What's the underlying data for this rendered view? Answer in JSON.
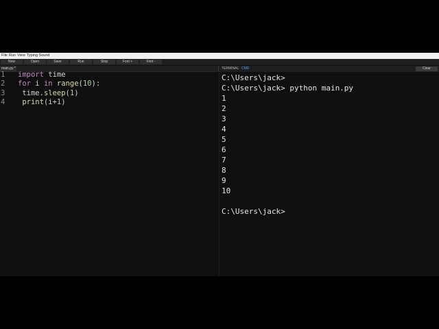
{
  "menubar": [
    "File",
    "Run",
    "View",
    "Typing Sound"
  ],
  "toolbar": {
    "new": "New",
    "open": "Open",
    "save": "Save",
    "run": "Run",
    "stop": "Stop",
    "font_plus": "Font +",
    "font_minus": "Font -"
  },
  "editor": {
    "tab_label": "main.py *",
    "lines": [
      {
        "num": "1",
        "tokens": [
          {
            "t": "import",
            "c": "kw"
          },
          {
            "t": " time",
            "c": ""
          }
        ]
      },
      {
        "num": "2",
        "tokens": [
          {
            "t": "for",
            "c": "kw"
          },
          {
            "t": " i ",
            "c": ""
          },
          {
            "t": "in",
            "c": "kw"
          },
          {
            "t": " ",
            "c": ""
          },
          {
            "t": "range",
            "c": "fn"
          },
          {
            "t": "(",
            "c": ""
          },
          {
            "t": "10",
            "c": "num"
          },
          {
            "t": "):",
            "c": ""
          }
        ]
      },
      {
        "num": "3",
        "tokens": [
          {
            "t": " time.",
            "c": ""
          },
          {
            "t": "sleep",
            "c": "fn"
          },
          {
            "t": "(",
            "c": ""
          },
          {
            "t": "1",
            "c": "num"
          },
          {
            "t": ")",
            "c": ""
          }
        ]
      },
      {
        "num": "4",
        "tokens": [
          {
            "t": " ",
            "c": ""
          },
          {
            "t": "print",
            "c": "fn"
          },
          {
            "t": "(i+",
            "c": ""
          },
          {
            "t": "1",
            "c": "num"
          },
          {
            "t": ")",
            "c": ""
          }
        ]
      }
    ]
  },
  "terminal": {
    "tab_terminal": "TERMINAL",
    "tab_cmd": "CMD",
    "clear_label": "Clear",
    "lines": [
      "C:\\Users\\jack>",
      "C:\\Users\\jack> python main.py",
      "1",
      "2",
      "3",
      "4",
      "5",
      "6",
      "7",
      "8",
      "9",
      "10",
      "",
      "C:\\Users\\jack>"
    ]
  },
  "colors": {
    "keyword": "#c586c0",
    "function": "#dcdcaa",
    "number": "#b5cea8",
    "cmd_tab": "#4aa3ff"
  }
}
